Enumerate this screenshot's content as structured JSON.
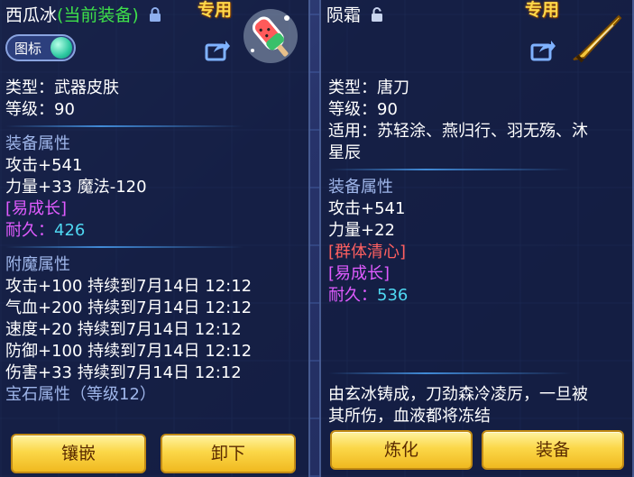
{
  "left_panel": {
    "title": "西瓜冰",
    "title_suffix": "(当前装备)",
    "exclusive_label": "专用",
    "icon_toggle_label": "图标",
    "type_line": "类型：武器皮肤",
    "level_line": "等级：90",
    "equip_attr_header": "装备属性",
    "attack_line": "攻击+541",
    "strength_magic_line": "力量+33 魔法-120",
    "tag_growth": "[易成长]",
    "durability_label": "耐久：",
    "durability_value": "426",
    "enchant_header": "附魔属性",
    "enchant_lines": [
      "攻击+100 持续到7月14日 12:12",
      "气血+200 持续到7月14日 12:12",
      "速度+20 持续到7月14日 12:12",
      "防御+100 持续到7月14日 12:12",
      "伤害+33 持续到7月14日 12:12"
    ],
    "gem_header": "宝石属性（等级12）",
    "button_inlay": "镶嵌",
    "button_unequip": "卸下"
  },
  "right_panel": {
    "title": "陨霜",
    "exclusive_label": "专用",
    "type_line": "类型：唐刀",
    "level_line": "等级：90",
    "applies_line_1": "适用：苏轻涂、燕归行、羽无殇、沐",
    "applies_line_2": "星辰",
    "equip_attr_header": "装备属性",
    "attack_line": "攻击+541",
    "strength_line": "力量+22",
    "tag_group_clear": "[群体清心]",
    "tag_growth": "[易成长]",
    "durability_label": "耐久：",
    "durability_value": "536",
    "description_line_1": "由玄冰铸成，刀劲森冷凌厉，一旦被",
    "description_line_2": "其所伤，血液都将冻结",
    "button_refine": "炼化",
    "button_equip": "装备"
  },
  "colors": {
    "section_header": "#9fb6ea",
    "value_cyan": "#4fd8f2",
    "tag_pink": "#e05bff",
    "tag_red": "#ff6060",
    "title_green": "#3ee04a",
    "exclusive_gold": "#ffd84a"
  },
  "icons": [
    "lock-closed-icon",
    "lock-open-icon",
    "share-icon",
    "watermelon-ice-skin-icon",
    "tang-blade-icon"
  ]
}
